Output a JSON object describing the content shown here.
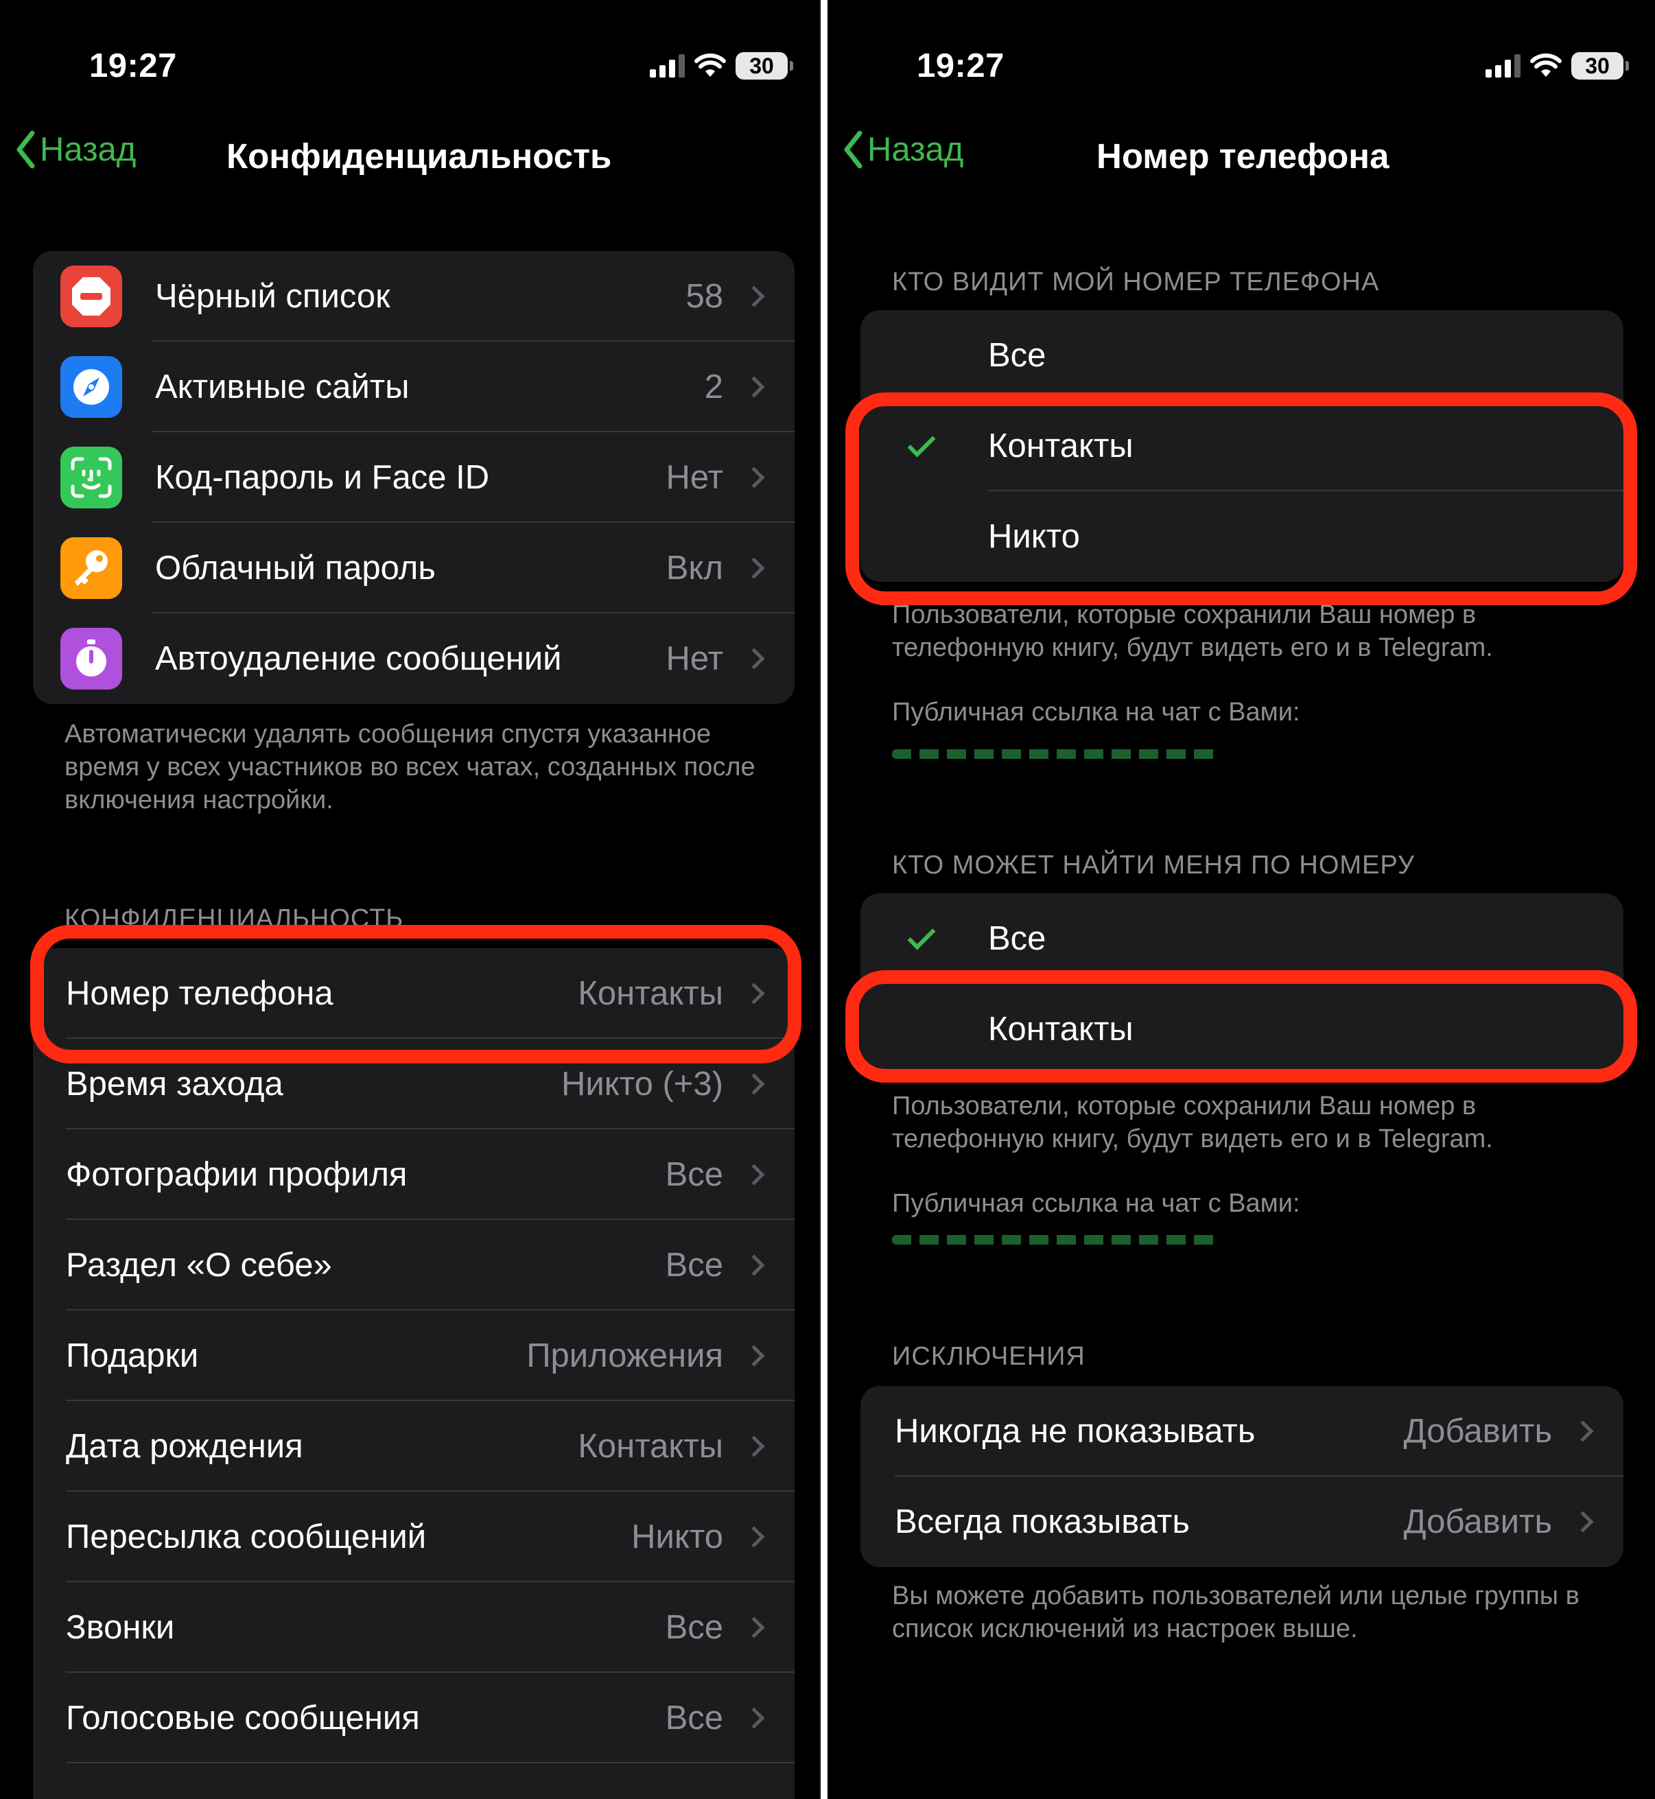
{
  "status_bar": {
    "time": "19:27",
    "battery": "30"
  },
  "left": {
    "back_label": "Назад",
    "title": "Конфиденциальность",
    "security_items": [
      {
        "label": "Чёрный список",
        "value": "58",
        "icon": "block-icon",
        "color": "#e9443a"
      },
      {
        "label": "Активные сайты",
        "value": "2",
        "icon": "compass-icon",
        "color": "#1e7cf2"
      },
      {
        "label": "Код-пароль и Face ID",
        "value": "Нет",
        "icon": "face-id-icon",
        "color": "#34c759"
      },
      {
        "label": "Облачный пароль",
        "value": "Вкл",
        "icon": "key-icon",
        "color": "#ff9a0a"
      },
      {
        "label": "Автоудаление сообщений",
        "value": "Нет",
        "icon": "timer-icon",
        "color": "#b051de"
      }
    ],
    "security_footer": "Автоматически удалять сообщения спустя указанное время у всех участников во всех чатах, созданных после включения настройки.",
    "privacy_header": "КОНФИДЕНЦИАЛЬНОСТЬ",
    "privacy_items": [
      {
        "label": "Номер телефона",
        "value": "Контакты"
      },
      {
        "label": "Время захода",
        "value": "Никто (+3)"
      },
      {
        "label": "Фотографии профиля",
        "value": "Все"
      },
      {
        "label": "Раздел «О себе»",
        "value": "Все"
      },
      {
        "label": "Подарки",
        "value": "Приложения"
      },
      {
        "label": "Дата рождения",
        "value": "Контакты"
      },
      {
        "label": "Пересылка сообщений",
        "value": "Никто"
      },
      {
        "label": "Звонки",
        "value": "Все"
      },
      {
        "label": "Голосовые сообщения",
        "value": "Все"
      }
    ]
  },
  "right": {
    "back_label": "Назад",
    "title": "Номер телефона",
    "who_sees_header": "КТО ВИДИТ МОЙ НОМЕР ТЕЛЕФОНА",
    "who_sees_options": [
      {
        "label": "Все",
        "checked": false
      },
      {
        "label": "Контакты",
        "checked": true
      },
      {
        "label": "Никто",
        "checked": false
      }
    ],
    "who_sees_footer": "Пользователи, которые сохранили Ваш номер в телефонную книгу, будут видеть его и в Telegram.",
    "who_sees_link_label": "Публичная ссылка на чат с Вами:",
    "who_finds_header": "КТО МОЖЕТ НАЙТИ МЕНЯ ПО НОМЕРУ",
    "who_finds_options": [
      {
        "label": "Все",
        "checked": true
      },
      {
        "label": "Контакты",
        "checked": false
      }
    ],
    "who_finds_footer": "Пользователи, которые сохранили Ваш номер в телефонную книгу, будут видеть его и в Telegram.",
    "who_finds_link_label": "Публичная ссылка на чат с Вами:",
    "exceptions_header": "ИСКЛЮЧЕНИЯ",
    "exceptions": [
      {
        "label": "Никогда не показывать",
        "value": "Добавить"
      },
      {
        "label": "Всегда показывать",
        "value": "Добавить"
      }
    ],
    "exceptions_footer": "Вы можете добавить пользователей или целые группы в список исключений из настроек выше."
  },
  "colors": {
    "accent": "#3fb84f",
    "highlight": "#ff2a12",
    "cell": "#1c1c1e",
    "secondary_text": "#8d8d93"
  }
}
